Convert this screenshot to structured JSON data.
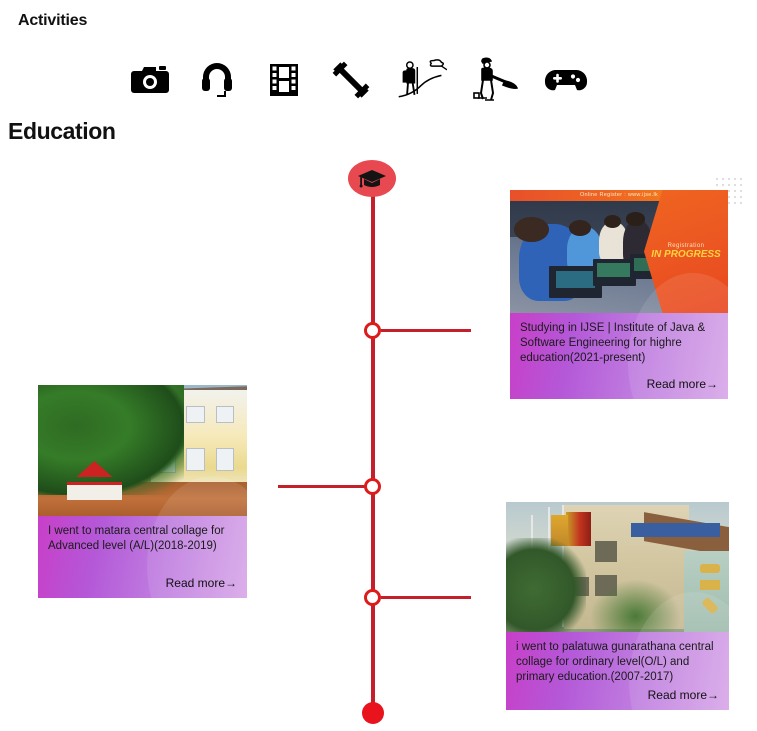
{
  "sections": {
    "activities_title": "Activities",
    "education_title": "Education"
  },
  "activities": {
    "icons": [
      {
        "name": "camera-icon",
        "label": "Photography"
      },
      {
        "name": "headphones-icon",
        "label": "Music"
      },
      {
        "name": "film-icon",
        "label": "Movies"
      },
      {
        "name": "dumbbell-icon",
        "label": "Gym"
      },
      {
        "name": "hiking-icon",
        "label": "Hiking"
      },
      {
        "name": "cricket-icon",
        "label": "Cricket"
      },
      {
        "name": "gamepad-icon",
        "label": "Gaming"
      }
    ]
  },
  "timeline": {
    "cap_icon": "graduation-cap-icon",
    "line_color": "#c4202a",
    "node_color": "#dd1b1b",
    "cap_bg_color": "#e8484f",
    "end_dot_color": "#e8131d",
    "node_count": 3
  },
  "cards": [
    {
      "id": "card-ijse",
      "side": "right",
      "image_name": "ijse-computer-lab-photo",
      "image_banner": "Online Register : www.ijse.lk",
      "image_overlay_line1": "Registration",
      "image_overlay_line2": "IN PROGRESS",
      "text": "Studying  in IJSE | Institute of Java & Software Engineering for highre education(2021-present)",
      "read_more": "Read more→"
    },
    {
      "id": "card-matara",
      "side": "left",
      "image_name": "matara-central-college-photo",
      "text": "I went to matara central collage for Advanced level (A/L)(2018-2019)",
      "read_more": "Read more→"
    },
    {
      "id": "card-palatuwa",
      "side": "right",
      "image_name": "palatuwa-gunarathana-college-photo",
      "text": "i went to palatuwa gunarathana central collage for ordinary level(O/L) and primary education.(2007-2017)",
      "read_more": "Read more→"
    }
  ],
  "decoration": {
    "dot_grid_name": "dot-grid-decoration",
    "dot_color": "#cfcfcf"
  },
  "theme": {
    "card_gradient_start": "#c83fc8",
    "card_gradient_end": "#d7a6e8",
    "background": "#ffffff",
    "text_color": "#1b1b1b"
  }
}
